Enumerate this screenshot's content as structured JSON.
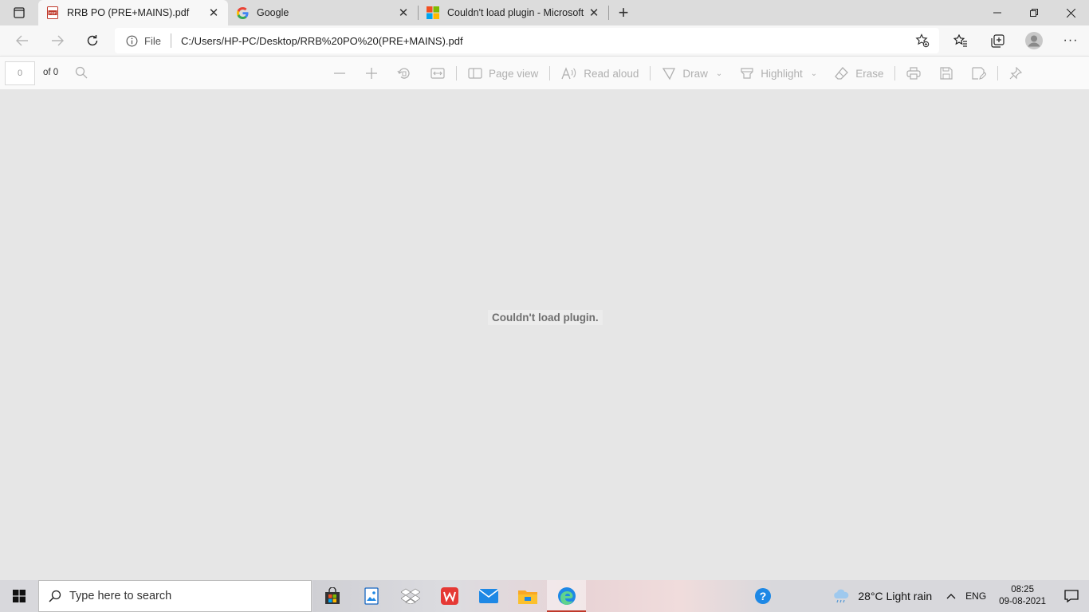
{
  "tabs": [
    {
      "title": "RRB PO (PRE+MAINS).pdf",
      "favicon": "pdf-icon",
      "active": true
    },
    {
      "title": "Google",
      "favicon": "google-icon",
      "active": false
    },
    {
      "title": "Couldn't load plugin - Microsoft",
      "favicon": "microsoft-icon",
      "active": false
    }
  ],
  "address": {
    "scheme_label": "File",
    "url": "C:/Users/HP-PC/Desktop/RRB%20PO%20(PRE+MAINS).pdf"
  },
  "pdf_toolbar": {
    "page_value": "0",
    "of_pages": "of 0",
    "page_view": "Page view",
    "read_aloud": "Read aloud",
    "draw": "Draw",
    "highlight": "Highlight",
    "erase": "Erase"
  },
  "content": {
    "message": "Couldn't load plugin."
  },
  "taskbar": {
    "search_placeholder": "Type here to search",
    "weather": "28°C  Light rain",
    "language": "ENG",
    "time": "08:25",
    "date": "09-08-2021"
  },
  "colors": {
    "accent_red": "#c0392b",
    "edge_blue": "#1e88e5"
  }
}
